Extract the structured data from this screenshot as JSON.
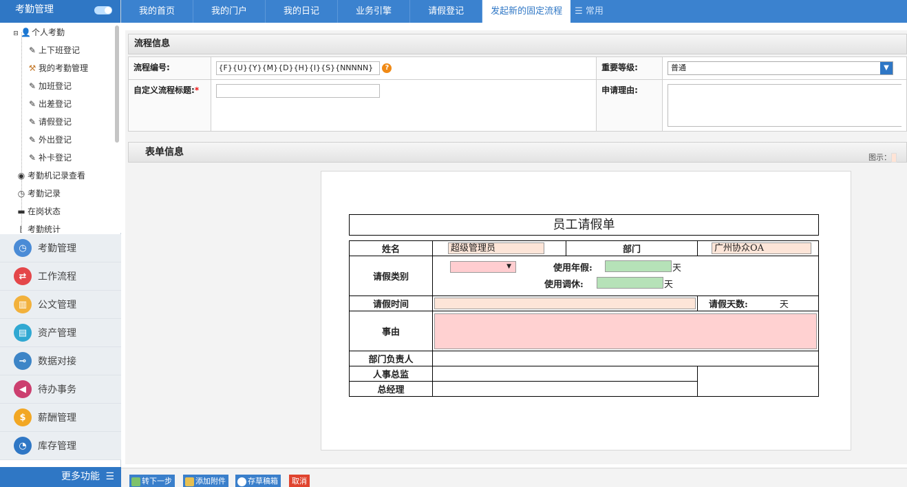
{
  "sidebar": {
    "title": "考勤管理",
    "tree": {
      "root": "个人考勤",
      "items": [
        "上下班登记",
        "我的考勤管理",
        "加班登记",
        "出差登记",
        "请假登记",
        "外出登记",
        "补卡登记",
        "考勤机记录查看",
        "考勤记录",
        "在岗状态",
        "考勤统计"
      ]
    },
    "menu": [
      {
        "label": "考勤管理",
        "color": "#4a8bd6"
      },
      {
        "label": "工作流程",
        "color": "#e4474a"
      },
      {
        "label": "公文管理",
        "color": "#f2b13c"
      },
      {
        "label": "资产管理",
        "color": "#30a8d2"
      },
      {
        "label": "数据对接",
        "color": "#3d85c7"
      },
      {
        "label": "待办事务",
        "color": "#cc3f6f"
      },
      {
        "label": "薪酬管理",
        "color": "#f2a724"
      },
      {
        "label": "库存管理",
        "color": "#2f77c5"
      }
    ],
    "more": "更多功能"
  },
  "tabs": {
    "items": [
      "我的首页",
      "我的门户",
      "我的日记",
      "业务引擎",
      "请假登记"
    ],
    "active": "发起新的固定流程",
    "common": "常用"
  },
  "flow": {
    "header": "流程信息",
    "no_label": "流程编号:",
    "no_value": "{F}{U}{Y}{M}{D}{H}{I}{S}{NNNNN}",
    "title_label": "自定义流程标题:",
    "title_value": "",
    "level_label": "重要等级:",
    "level_value": "普通",
    "reason_label": "申请理由:"
  },
  "form": {
    "header": "表单信息",
    "legend": "图示："
  },
  "leave": {
    "title": "员工请假单",
    "name_label": "姓名",
    "name_value": "超级管理员",
    "dept_label": "部门",
    "dept_value": "广州协众OA",
    "type_label": "请假类别",
    "annual_label": "使用年假:",
    "comp_label": "使用调休:",
    "day_unit": "天",
    "time_label": "请假时间",
    "days_label": "请假天数:",
    "reason_label": "事由",
    "mgr_label": "部门负责人",
    "hr_label": "人事总监",
    "gm_label": "总经理"
  },
  "buttons": {
    "next": "转下一步",
    "attach": "添加附件",
    "draft": "存草稿箱",
    "cancel": "取消"
  }
}
